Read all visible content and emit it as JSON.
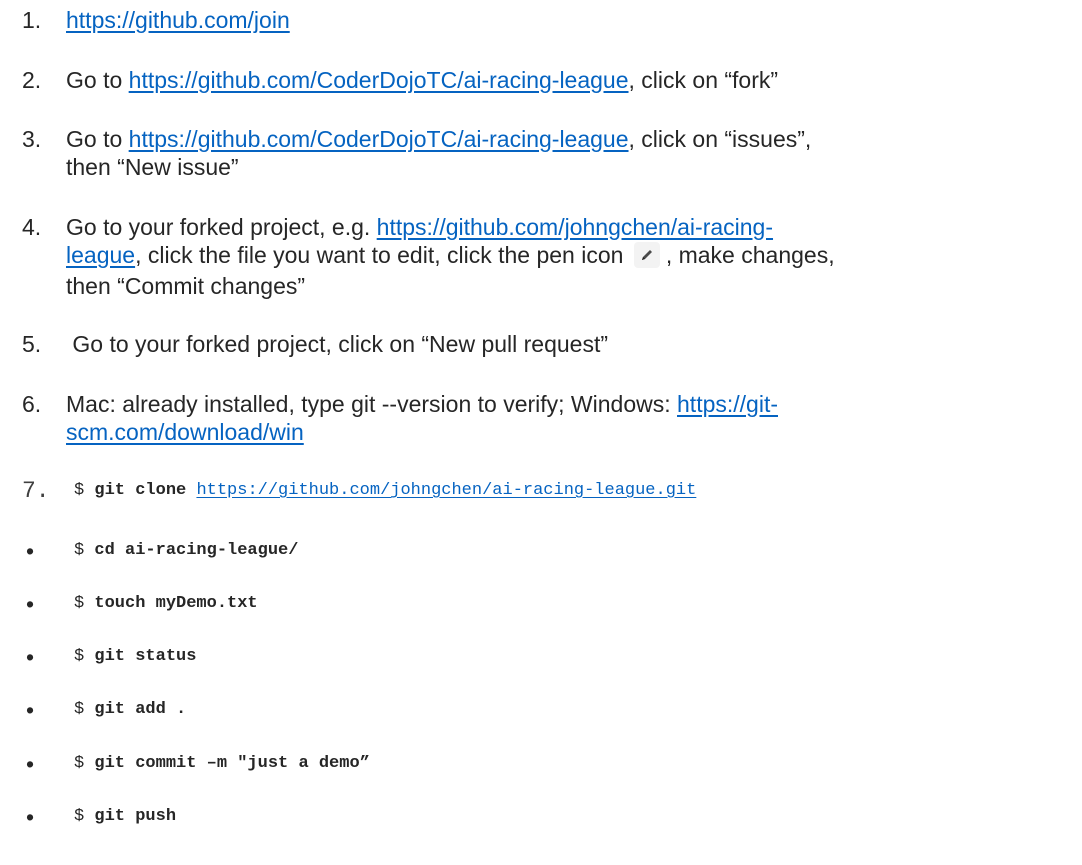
{
  "steps": [
    {
      "num": "1.",
      "link": "https://github.com/join"
    },
    {
      "num": "2.",
      "pre": "Go to ",
      "link": "https://github.com/CoderDojoTC/ai-racing-league",
      "post": ", click on “fork”"
    },
    {
      "num": "3.",
      "pre": "Go to ",
      "link": "https://github.com/CoderDojoTC/ai-racing-league",
      "post": ", click on “issues”,",
      "line2": "then “New issue”"
    },
    {
      "num": "4.",
      "pre": "Go to your forked project, e.g. ",
      "link_part1": "https://github.com/johngchen/ai-racing-",
      "link_part2": "league",
      "mid": ", click the file you want to edit, click the pen icon",
      "post": ",  make changes,",
      "line3": "then “Commit changes”"
    },
    {
      "num": "5.",
      "text": " Go to your forked project, click on “New pull request”"
    },
    {
      "num": "6.",
      "pre": "Mac: already installed, type git --version to verify; Windows: ",
      "link_part1": "https://git-",
      "link_part2": "scm.com/download/win"
    }
  ],
  "clone": {
    "num": "7.",
    "dollar": "$",
    "command": "git clone",
    "url": "https://github.com/johngchen/ai-racing-league.git"
  },
  "commands": [
    {
      "bullet": "•",
      "dollar": "$",
      "command": "cd ai-racing-league/"
    },
    {
      "bullet": "•",
      "dollar": "$",
      "command": "touch myDemo.txt"
    },
    {
      "bullet": "•",
      "dollar": "$",
      "command": "git status"
    },
    {
      "bullet": "•",
      "dollar": "$",
      "command": "git add ."
    },
    {
      "bullet": "•",
      "dollar": "$",
      "command": "git commit –m \"just a demo”"
    },
    {
      "bullet": "•",
      "dollar": "$",
      "command": "git push"
    }
  ],
  "icons": {
    "pen": "pen-icon"
  },
  "colors": {
    "link": "#0563c1",
    "text": "#262626"
  }
}
